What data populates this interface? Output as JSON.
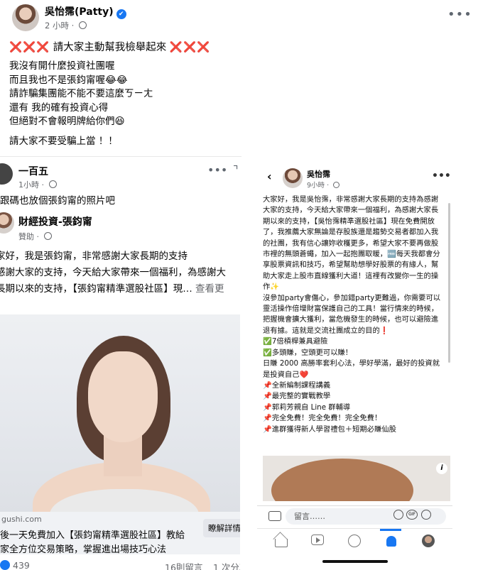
{
  "post": {
    "author": "吳怡霈(Patty)",
    "time": "2 小時",
    "meta_sep": "·",
    "headline_xx": "❌❌❌",
    "headline_text": " 請大家主動幫我檢舉起來 ",
    "lines": [
      "我沒有開什麼投資社團喔",
      "而且我也不是張鈞甯喔😂😂",
      "請詐騙集團能不能不要這麼ㄎㄧㄤ",
      "還有 我的確有投資心得",
      "但絕對不會報明牌給你們😆"
    ],
    "closing": "請大家不要受騙上當 ！！"
  },
  "left_screenshot": {
    "commenter": "一百五",
    "comment_time": "1小時 · ",
    "comment_text": "跟碼也放個張鈞甯的照片吧",
    "ad_page": "財經投資-張鈞甯",
    "ad_sponsored": "贊助 · ",
    "ad_lines": [
      "家好，我是張鈞甯，非常感謝大家長期的支持",
      "感謝大家的支持，今天給大家帶來一個福利，為感謝大",
      "長期以來的支持，【張鈞甯精準選股社區】現… "
    ],
    "see_more": "查看更",
    "domain": "gushi.com",
    "ad_title_lines": [
      "後一天免費加入【張鈞甯精準選股社區】教給",
      "家全方位交易策略，掌握進出場技巧心法"
    ],
    "cta": "瞭解詳情",
    "reactions": "439",
    "comments": "16則留言",
    "shares": "1 次分享"
  },
  "right_screenshot": {
    "name": "吳怡霈",
    "time": "9小時 · ",
    "paragraphs": [
      "大家好，我是吳怡霈，非常感謝大家長期的支持為感謝大家的支持，今天給大家帶來一個福利，為感謝大家長期以來的支持，【吳怡霈精準選股社區】現在免費開放了，我推薦大家無論是存股族還是趨勢交易者都加入我的社團，我有信心讓妳收穫更多，希望大家不要再做股市裡的無頭蒼蠅，加入一起抱團取暖，🆓每天我都會分享股票資訊和技巧，希望幫助想學好股票的有緣人，幫助大家走上股市直線獲利大道！這裡有改變你一生的操作✨",
      "沒參加party會傷心，參加錯party更難過，你需要可以靈活操作倍增財富保護自己的工具！當行情來的時候，把握機會擴大獲利，當危機發生的時候，也可以避險進退有據。這就是交流社團成立的目的❗",
      "✅7倍槓桿兼具避險",
      "✅多頭賺，空頭更可以賺！",
      "日賺 2000 高勝率套利心法，學好學滿，最好的投資就是投資自己❤️",
      "📌全新編制課程講義",
      "📌最完整的實戰教學",
      "📌郭莉芳親自 Line 群輔導",
      "📌完全免費！完全免費！完全免費！",
      "📌進群獲得新人學習禮包＋短期必賺仙股"
    ],
    "comment_placeholder": "留言……",
    "gif_label": "GIF"
  },
  "icons": {
    "verified": "verified-badge-icon",
    "globe": "globe-icon",
    "more": "more-options-icon"
  },
  "colors": {
    "accent": "#1877f2",
    "xx_red": "#e1272a"
  }
}
